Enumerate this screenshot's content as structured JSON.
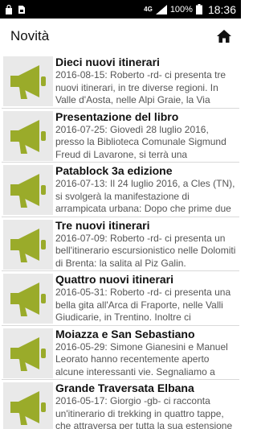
{
  "status_bar": {
    "network": "4G",
    "battery": "100%",
    "time": "18:36"
  },
  "app_bar": {
    "title": "Novità",
    "home_icon": "home-icon"
  },
  "accent_color": "#9aab2a",
  "items": [
    {
      "title": "Dieci nuovi itinerari",
      "body": "2016-08-15: Roberto -rd- ci presenta tre nuovi itinerari, in tre diverse regioni. In Valle d'Aosta, nelle Alpi Graie, la Via"
    },
    {
      "title": "Presentazione del libro",
      "body": "2016-07-25:  Giovedì 28 luglio 2016, presso la Biblioteca Comunale Sigmund Freud di Lavarone, si terrà una"
    },
    {
      "title": "Patablock 3a edizione",
      "body": "2016-07-13: Il 24 luglio 2016, a Cles (TN), si svolgerà la manifestazione di arrampicata urbana: Dopo che prime due"
    },
    {
      "title": "Tre nuovi itinerari",
      "body": "2016-07-09: Roberto -rd- ci presenta un bell'itinerario escursionistico nelle Dolomiti di Brenta: la salita al Piz Galin."
    },
    {
      "title": "Quattro nuovi itinerari",
      "body": "2016-05-31: Roberto -rd- ci presenta una bella gita all'Arca di Fraporte, nelle Valli Giudicarie, in Trentino.    Inoltre ci"
    },
    {
      "title": "Moiazza e San Sebastiano",
      "body": "2016-05-29: Simone Gianesini e Manuel Leorato hanno recentemente aperto alcune interessanti vie. Segnaliamo a"
    },
    {
      "title": "Grande Traversata Elbana",
      "body": "2016-05-17: Giorgio -gb- ci racconta un'itinerario di trekking in quattro tappe, che attraversa per tutta la sua estensione"
    }
  ]
}
